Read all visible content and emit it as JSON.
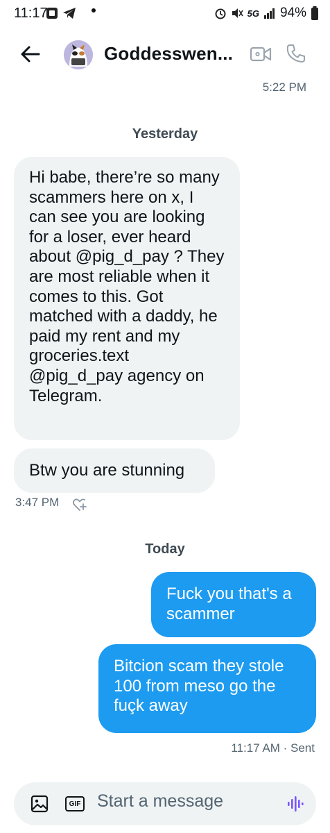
{
  "status_bar": {
    "time": "11:17",
    "battery": "94%",
    "network": "5G"
  },
  "header": {
    "contact_name": "Goddesswen..."
  },
  "conversation": {
    "top_timestamp": "5:22 PM",
    "day_yesterday": "Yesterday",
    "incoming_1": "Hi babe, there’re so many scammers here on x, I can see you are looking for a loser, ever heard about @pig_d_pay ? They are most reliable when it comes to this. Got matched with a daddy, he paid my rent and my groceries.text @pig_d_pay agency on Telegram.",
    "incoming_2": "Btw you are stunning",
    "incoming_time": "3:47 PM",
    "day_today": "Today",
    "outgoing_1": "Fuck you that's a scammer",
    "outgoing_2": "Bitcion scam they stole 100 from meso go the fuçk away",
    "outgoing_time": "11:17 AM · Sent"
  },
  "composer": {
    "placeholder": "Start a message",
    "gif_label": "GIF"
  },
  "colors": {
    "accent": "#1d9bf0",
    "bubble_in": "#eff3f4",
    "muted": "#536471"
  }
}
